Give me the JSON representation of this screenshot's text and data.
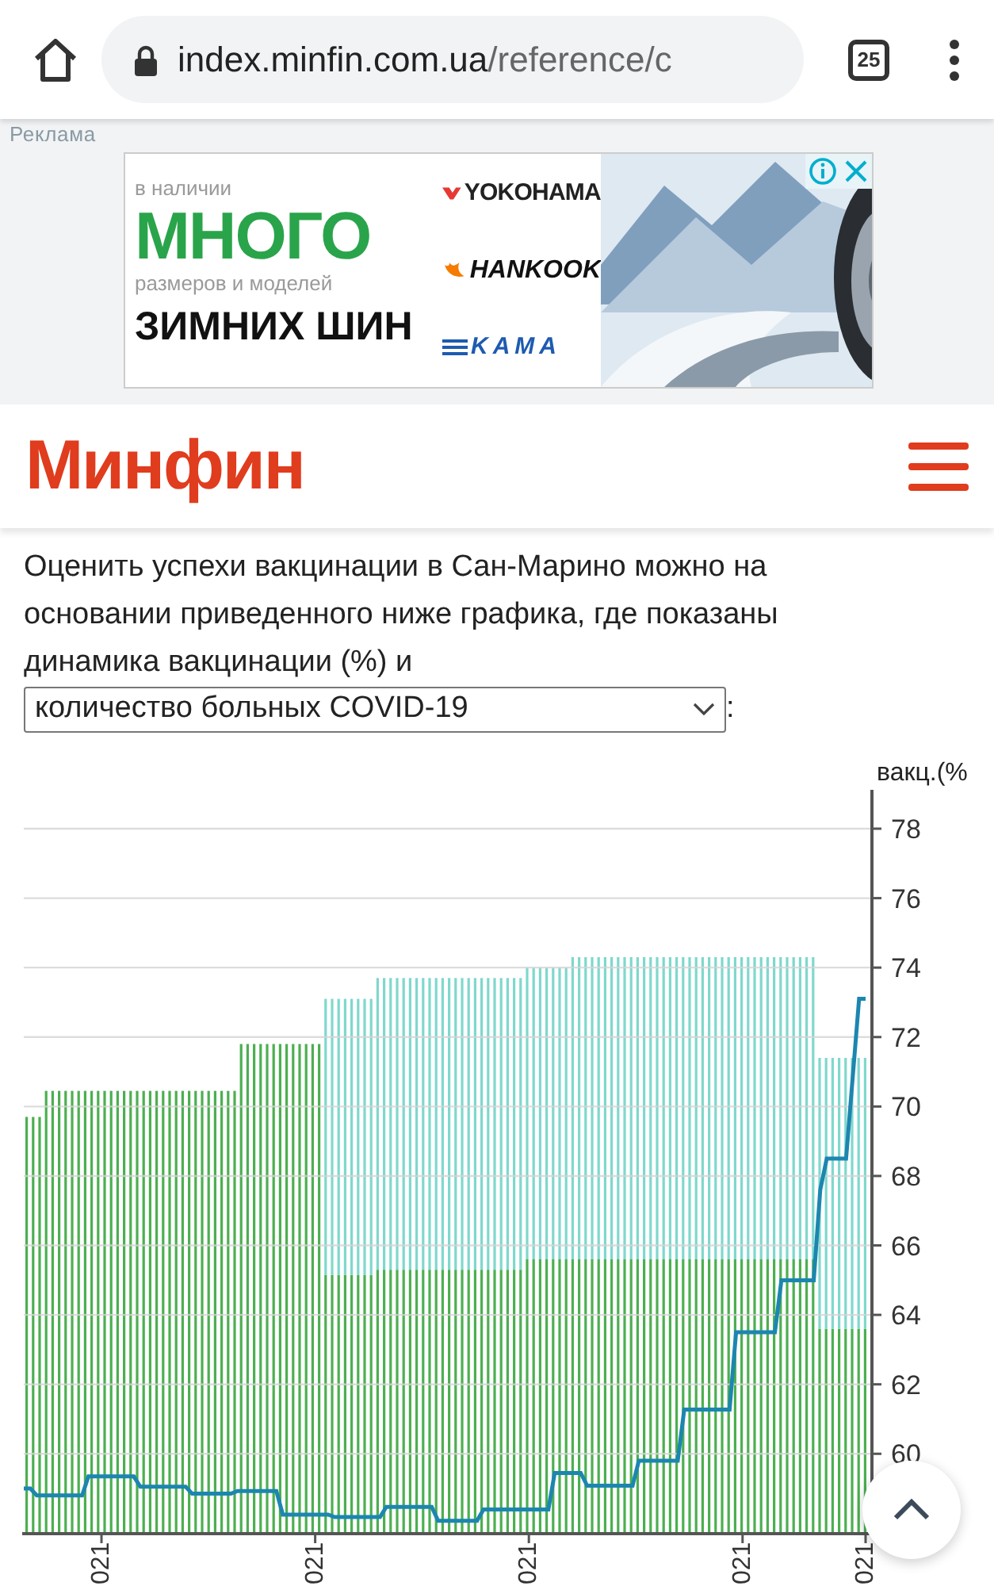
{
  "browser": {
    "url_host": "index.minfin.com.ua",
    "url_path": "/reference/c",
    "tab_count": "25"
  },
  "ad": {
    "label": "Реклама",
    "lines": [
      {
        "text": "в наличии",
        "kind": "small"
      },
      {
        "text": "МНОГО",
        "kind": "big"
      },
      {
        "text": "размеров и моделей",
        "kind": "small"
      },
      {
        "text": "ЗИМНИХ ШИН",
        "kind": "bold"
      }
    ],
    "brands": [
      {
        "text": "YOKOHAMA",
        "kind": "chevron"
      },
      {
        "text": "HANKOOK",
        "kind": "flame"
      },
      {
        "text": "KAMA",
        "kind": "stripes"
      }
    ]
  },
  "header": {
    "logo": "Минфин"
  },
  "intro": {
    "text": "Оценить успехи вакцинации в Сан-Марино можно на основании приведенного ниже графика, где показаны динамика вакцинации (%) и",
    "select_value": "количество больных COVID-19",
    "suffix": ":"
  },
  "chart": {
    "chart_data": {
      "type": "line",
      "grid": true,
      "ylabel": "вакц.(%",
      "ylim": [
        57.7,
        79
      ],
      "yticks": [
        60,
        62,
        64,
        66,
        68,
        70,
        72,
        74,
        76,
        78
      ],
      "categories": [
        null,
        null,
        null,
        null,
        null,
        null,
        null,
        null,
        null,
        null,
        null,
        null,
        "021",
        null,
        null,
        null,
        null,
        null,
        null,
        null,
        null,
        null,
        null,
        null,
        null,
        null,
        null,
        null,
        null,
        null,
        null,
        null,
        null,
        null,
        null,
        null,
        null,
        null,
        null,
        null,
        null,
        null,
        null,
        null,
        null,
        "021",
        null,
        null,
        null,
        null,
        null,
        null,
        null,
        null,
        null,
        null,
        null,
        null,
        null,
        null,
        null,
        null,
        null,
        null,
        null,
        null,
        null,
        null,
        null,
        null,
        null,
        null,
        null,
        null,
        null,
        null,
        null,
        null,
        "021",
        null,
        null,
        null,
        null,
        null,
        null,
        null,
        null,
        null,
        null,
        null,
        null,
        null,
        null,
        null,
        null,
        null,
        null,
        null,
        null,
        null,
        null,
        null,
        null,
        null,
        null,
        null,
        null,
        null,
        null,
        null,
        null,
        "021",
        null,
        null,
        null,
        null,
        null,
        null,
        null,
        null,
        null,
        null,
        null,
        null,
        null,
        null,
        null,
        null,
        null,
        null,
        "021"
      ],
      "series": [
        {
          "color": "#1c86b0",
          "values": [
            59.0,
            59.0,
            58.8,
            58.8,
            58.8,
            58.8,
            58.8,
            58.8,
            58.8,
            58.8,
            59.35,
            59.35,
            59.35,
            59.35,
            59.35,
            59.35,
            59.35,
            59.35,
            59.05,
            59.05,
            59.05,
            59.05,
            59.05,
            59.05,
            59.05,
            59.05,
            58.85,
            58.85,
            58.85,
            58.85,
            58.85,
            58.85,
            58.85,
            58.93,
            58.93,
            58.93,
            58.93,
            58.93,
            58.93,
            58.93,
            58.25,
            58.25,
            58.25,
            58.25,
            58.25,
            58.25,
            58.25,
            58.25,
            58.18,
            58.18,
            58.18,
            58.18,
            58.18,
            58.18,
            58.18,
            58.18,
            58.47,
            58.47,
            58.47,
            58.47,
            58.47,
            58.47,
            58.47,
            58.47,
            58.07,
            58.07,
            58.07,
            58.07,
            58.07,
            58.07,
            58.07,
            58.4,
            58.4,
            58.4,
            58.4,
            58.4,
            58.4,
            58.4,
            58.4,
            58.4,
            58.4,
            58.4,
            59.45,
            59.45,
            59.45,
            59.45,
            59.45,
            59.08,
            59.08,
            59.08,
            59.08,
            59.08,
            59.08,
            59.08,
            59.08,
            59.8,
            59.8,
            59.8,
            59.8,
            59.8,
            59.8,
            59.8,
            61.27,
            61.27,
            61.27,
            61.27,
            61.27,
            61.27,
            61.27,
            61.27,
            63.5,
            63.5,
            63.5,
            63.5,
            63.5,
            63.5,
            63.5,
            65.0,
            65.0,
            65.0,
            65.0,
            65.0,
            65.0,
            67.6,
            68.5,
            68.5,
            68.5,
            68.5,
            70.8,
            73.1,
            73.1
          ]
        }
      ]
    }
  }
}
